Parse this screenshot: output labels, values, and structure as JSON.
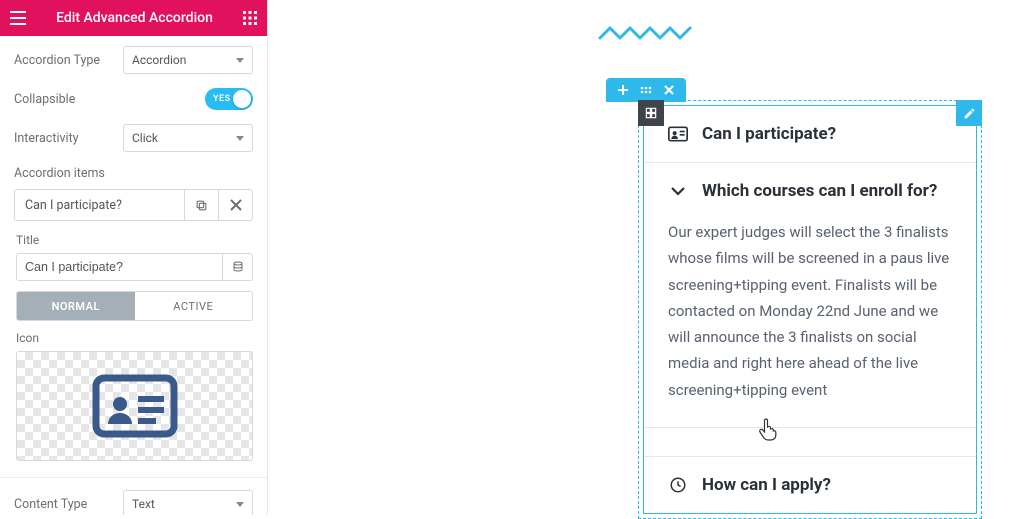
{
  "header": {
    "title": "Edit Advanced Accordion"
  },
  "fields": {
    "type_label": "Accordion Type",
    "type_value": "Accordion",
    "collapsible_label": "Collapsible",
    "collapsible_toggle_text": "YES",
    "interactivity_label": "Interactivity",
    "interactivity_value": "Click",
    "items_label": "Accordion items",
    "content_type_label": "Content Type",
    "content_type_value": "Text"
  },
  "item": {
    "name": "Can I participate?",
    "title_label": "Title",
    "title_value": "Can I participate?",
    "tab_normal": "NORMAL",
    "tab_active": "ACTIVE",
    "icon_label": "Icon"
  },
  "preview": {
    "q1": "Can I participate?",
    "q2": "Which courses can I enroll for?",
    "q2_body": "Our expert judges will select the 3 finalists whose films will be screened in a paus live screening+tipping event. Finalists will be contacted on Monday 22nd June and we will announce the 3 finalists on social media and right here ahead of the live screening+tipping event",
    "q3": "How can I apply?"
  }
}
